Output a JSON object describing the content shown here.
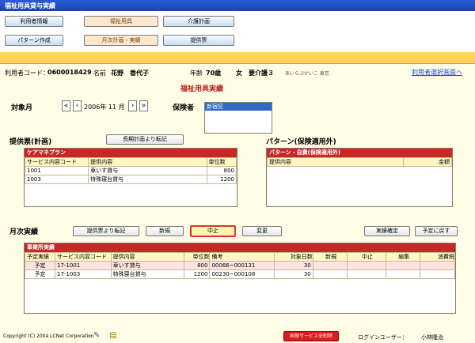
{
  "window": {
    "title": "福祉用具貸与実績"
  },
  "nav": {
    "row1": [
      "利用者情報",
      "福祉用具",
      "介護計画"
    ],
    "row2": [
      "パターン作成",
      "月次計画・実績",
      "提供票"
    ]
  },
  "user": {
    "code_label": "利用者コード：",
    "code": "0600018429",
    "name_label": "名前",
    "name": "花野　香代子",
    "age_label": "年齢",
    "age": "70歳",
    "sex": "女",
    "care": "要介護３",
    "kana": "あいらぷかいこ 東京",
    "select_link": "利用者選択画面へ"
  },
  "page": {
    "title": "福祉用具実績",
    "target_month_label": "対象月",
    "month_value": "2006年 11 月",
    "insurer_label": "保険者",
    "insurer_selected": "新宿区"
  },
  "plan": {
    "label": "提供票(計画)",
    "transfer_btn": "長期計画より転記",
    "panel_title": "ケアマネプラン",
    "columns": [
      "サービス内容コード",
      "提供内容",
      "単位数"
    ],
    "rows": [
      [
        "1001",
        "車いす貸与",
        "800"
      ],
      [
        "1003",
        "特殊寝台貸与",
        "1200"
      ]
    ]
  },
  "pattern": {
    "label": "パターン(保険適用外)",
    "panel_title": "パターン・自費(保険適用外)",
    "columns": [
      "提供内容",
      "金額"
    ]
  },
  "monthly": {
    "label": "月次実績",
    "buttons": [
      "提供票より転記",
      "新規",
      "中止",
      "変更",
      "実績確定",
      "予定に戻す"
    ],
    "panel_title": "事業所実績",
    "columns": [
      "予定実績",
      "サービス内容コード",
      "提供内容",
      "単位数",
      "備考",
      "対象日数",
      "新規",
      "中止",
      "編集",
      "消費税"
    ],
    "rows": [
      [
        "予定",
        "17-1001",
        "車いす貸与",
        "800",
        "00066~000131",
        "30",
        "",
        "",
        "",
        ""
      ],
      [
        "予定",
        "17-1003",
        "特殊寝台貸与",
        "1200",
        "00230~000108",
        "30",
        "",
        "",
        "",
        ""
      ]
    ]
  },
  "footer": {
    "copyright": "Copyright (C) 2004 LCNet Corporation",
    "delete_btn": "国保サービス全削除",
    "login_label": "ログインユーザー：",
    "login_user": "小林隆治"
  }
}
